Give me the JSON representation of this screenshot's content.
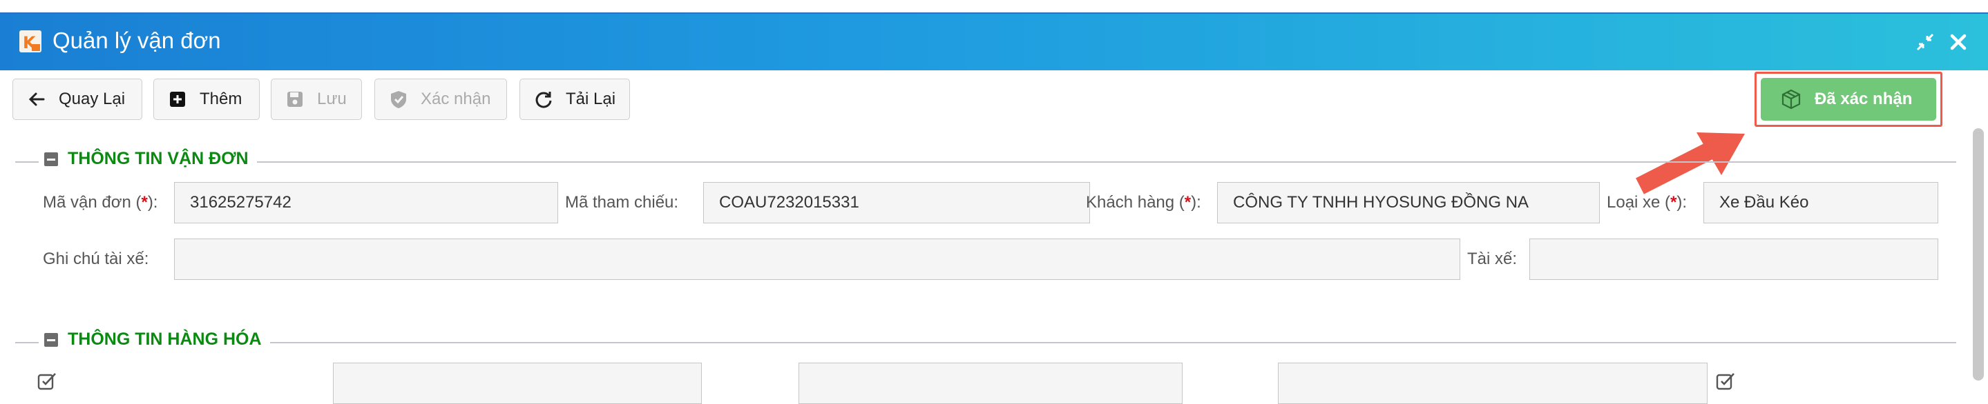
{
  "window": {
    "title": "Quản lý vận đơn",
    "accent_color": "#1f9be0"
  },
  "toolbar": {
    "back_label": "Quay Lại",
    "add_label": "Thêm",
    "save_label": "Lưu",
    "confirm_label": "Xác nhận",
    "reload_label": "Tải Lại",
    "confirmed_label": "Đã xác nhận",
    "confirmed_color": "#72c879",
    "highlight_color": "#ee5b4a"
  },
  "section1": {
    "title": "THÔNG TIN VẬN ĐƠN",
    "fields": {
      "waybill_label": "Mã vận đơn (",
      "waybill_req": "*",
      "waybill_close": "):",
      "waybill_value": "31625275742",
      "ref_label": "Mã tham chiếu:",
      "ref_value": "COAU7232015331",
      "customer_label": "Khách hàng (",
      "customer_req": "*",
      "customer_close": "):",
      "customer_value": "CÔNG TY TNHH HYOSUNG ĐỒNG NA",
      "vehicle_label": "Loại xe (",
      "vehicle_req": "*",
      "vehicle_close": "):",
      "vehicle_value": "Xe Đầu Kéo",
      "driver_note_label": "Ghi chú tài xế:",
      "driver_note_value": "",
      "driver_label": "Tài xế:",
      "driver_value": ""
    }
  },
  "section2": {
    "title": "THÔNG TIN HÀNG HÓA"
  }
}
